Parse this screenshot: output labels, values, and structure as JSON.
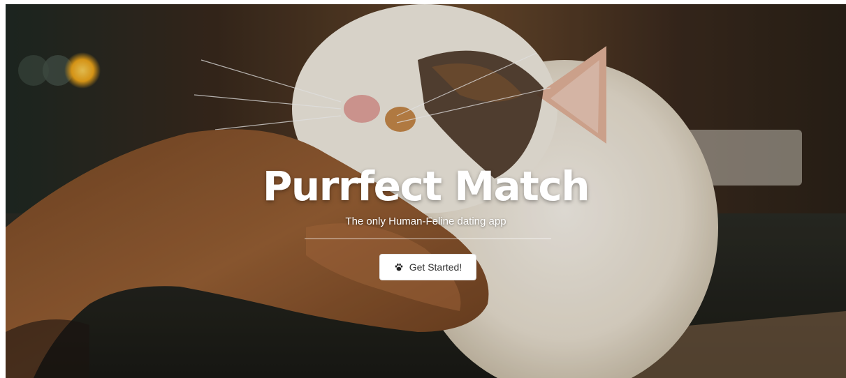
{
  "hero": {
    "title": "Purrfect Match",
    "subtitle": "The only Human-Feline dating app",
    "cta": {
      "label": "Get Started!",
      "icon": "paw-icon"
    }
  },
  "colors": {
    "page_background": "#ffffff",
    "title_text": "#ffffff",
    "button_background": "#ffffff",
    "button_text": "#333333"
  }
}
